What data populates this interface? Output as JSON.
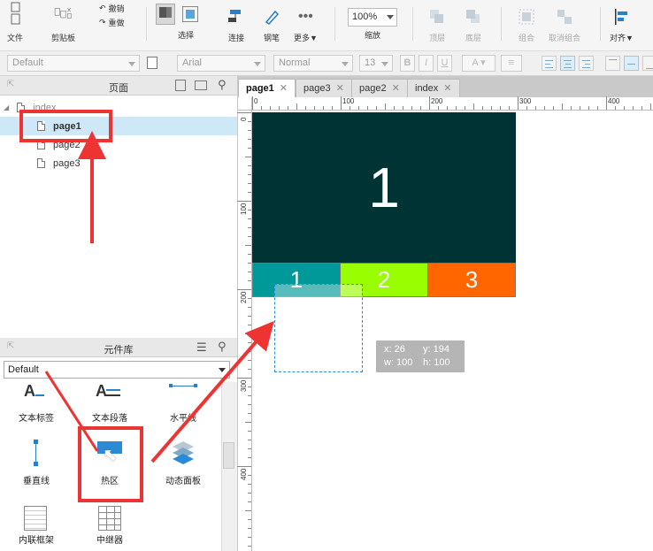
{
  "toolbar": {
    "file": "文件",
    "clipboard": "剪贴板",
    "undo": "撤销",
    "redo": "重做",
    "select": "选择",
    "connect": "连接",
    "pen": "钢笔",
    "more": "更多▼",
    "zoom_value": "100%",
    "zoom_label": "缩放",
    "top_layer": "顶层",
    "bottom_layer": "底层",
    "group": "组合",
    "ungroup": "取消组合",
    "align": "对齐▼"
  },
  "format": {
    "style": "Default",
    "font": "Arial",
    "weight": "Normal",
    "size": "13",
    "bold": "B",
    "italic": "I",
    "underline": "U",
    "color_a": "A"
  },
  "pages_panel": {
    "title": "页面",
    "items": [
      {
        "label": "index"
      },
      {
        "label": "page1"
      },
      {
        "label": "page2"
      },
      {
        "label": "page3"
      }
    ]
  },
  "library": {
    "title": "元件库",
    "selected": "Default",
    "widgets": [
      {
        "label": "文本标签",
        "icon": "text-label-icon"
      },
      {
        "label": "文本段落",
        "icon": "text-paragraph-icon"
      },
      {
        "label": "水平线",
        "icon": "horizontal-line-icon"
      },
      {
        "label": "垂直线",
        "icon": "vertical-line-icon"
      },
      {
        "label": "热区",
        "icon": "hotspot-icon"
      },
      {
        "label": "动态面板",
        "icon": "dynamic-panel-icon"
      },
      {
        "label": "内联框架",
        "icon": "inline-frame-icon"
      },
      {
        "label": "中继器",
        "icon": "repeater-icon"
      }
    ]
  },
  "tabs": [
    {
      "label": "page1"
    },
    {
      "label": "page3"
    },
    {
      "label": "page2"
    },
    {
      "label": "index"
    }
  ],
  "rulers": {
    "h": [
      "0",
      "100",
      "200",
      "300",
      "400"
    ],
    "v": [
      "0",
      "100",
      "200",
      "300",
      "400"
    ]
  },
  "canvas": {
    "banner": "1",
    "nav": [
      {
        "label": "1",
        "color": "#009999"
      },
      {
        "label": "2",
        "color": "#99ff00"
      },
      {
        "label": "3",
        "color": "#ff6600"
      }
    ],
    "banner_color": "#003333",
    "tooltip": {
      "x": "x: 26",
      "y": "y: 194",
      "w": "w: 100",
      "h": "h: 100"
    }
  },
  "annotation_color": "#ee3333"
}
